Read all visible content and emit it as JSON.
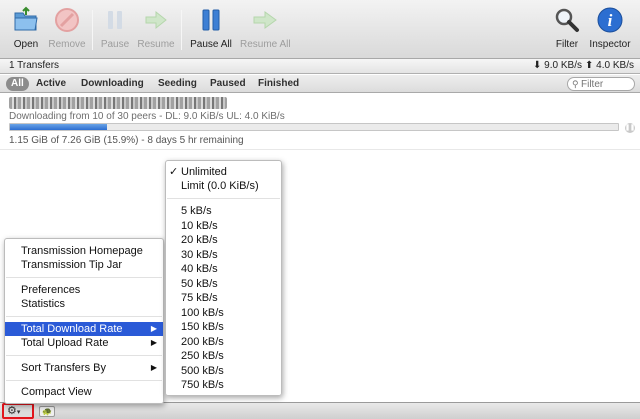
{
  "toolbar": {
    "open": "Open",
    "remove": "Remove",
    "pause": "Pause",
    "resume": "Resume",
    "pause_all": "Pause All",
    "resume_all": "Resume All",
    "filter": "Filter",
    "inspector": "Inspector"
  },
  "status": {
    "transfers": "1 Transfers",
    "download_speed": "9.0 KB/s",
    "upload_speed": "4.0 KB/s"
  },
  "filter_tabs": [
    "All",
    "Active",
    "Downloading",
    "Seeding",
    "Paused",
    "Finished"
  ],
  "filter_placeholder": "Filter",
  "torrent": {
    "status": "Downloading from 10 of 30 peers - DL: 9.0 KiB/s UL: 4.0 KiB/s",
    "progress_text": "1.15 GiB of 7.26 GiB (15.9%) - 8 days 5 hr remaining",
    "progress_fraction": 0.159
  },
  "main_menu": {
    "homepage": "Transmission Homepage",
    "tip_jar": "Transmission Tip Jar",
    "preferences": "Preferences",
    "statistics": "Statistics",
    "total_download_rate": "Total Download Rate",
    "total_upload_rate": "Total Upload Rate",
    "sort_transfers_by": "Sort Transfers By",
    "compact_view": "Compact View"
  },
  "rate_menu": {
    "unlimited": "Unlimited",
    "limit": "Limit (0.0 KiB/s)",
    "rates": [
      "5 kB/s",
      "10 kB/s",
      "20 kB/s",
      "30 kB/s",
      "40 kB/s",
      "50 kB/s",
      "75 kB/s",
      "100 kB/s",
      "150 kB/s",
      "200 kB/s",
      "250 kB/s",
      "500 kB/s",
      "750 kB/s"
    ]
  },
  "colors": {
    "accent": "#2a5ad7",
    "progress": "#3b7ddb",
    "highlight_border": "#e2141b"
  }
}
